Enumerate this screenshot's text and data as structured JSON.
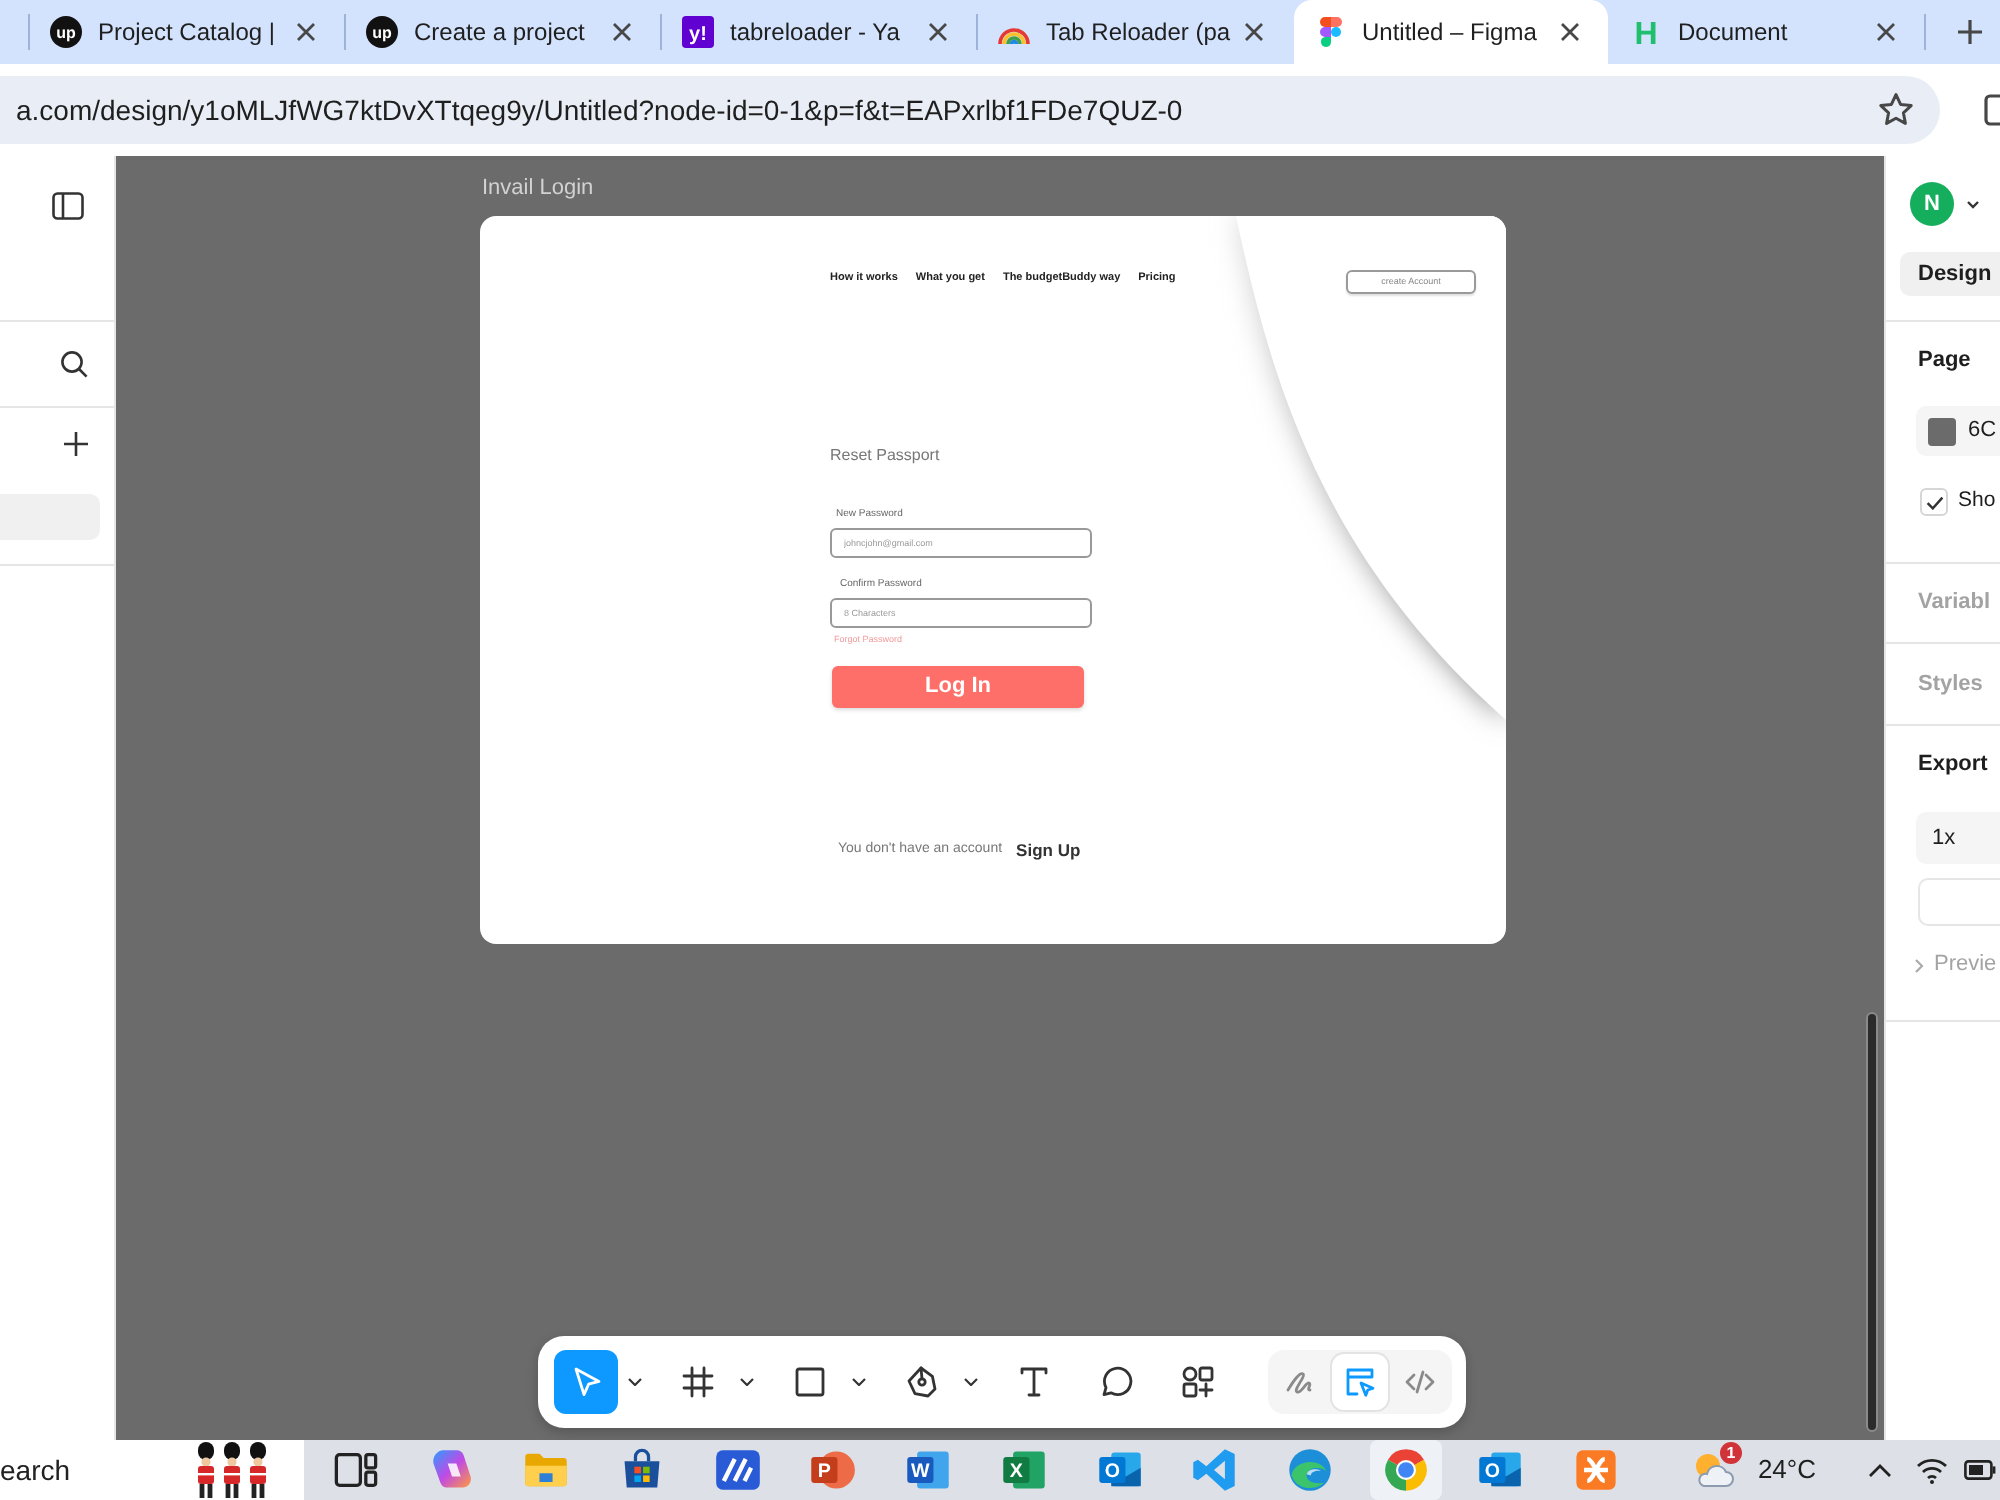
{
  "browser": {
    "tabs": [
      {
        "kind": "disc",
        "logo_text": "up",
        "title": "Project Catalog |",
        "selected": false
      },
      {
        "kind": "disc",
        "logo_text": "up",
        "title": "Create a project",
        "selected": false
      },
      {
        "kind": "tile",
        "logo_text": "y!",
        "title": "tabreloader - Ya",
        "selected": false
      },
      {
        "kind": "arc",
        "title": "Tab Reloader (pa",
        "selected": false
      },
      {
        "kind": "shapes",
        "title": "Untitled – Figma",
        "selected": true
      },
      {
        "kind": "letter",
        "logo_text": "H",
        "title": "Document",
        "selected": false
      }
    ],
    "address": "a.com/design/y1oMLJfWG7ktDvXTtqeg9y/Untitled?node-id=0-1&p=f&t=EAPxrlbf1FDe7QUZ-0"
  },
  "canvas": {
    "frame_label": "Invail Login",
    "frame": {
      "nav": [
        "How it works",
        "What you get",
        "The budgetBuddy way",
        "Pricing"
      ],
      "header_button": "create Account",
      "heading": "Reset Passport",
      "fields": [
        {
          "label": "New Password",
          "placeholder": "johncjohn@gmail.com"
        },
        {
          "label": "Confirm Password",
          "placeholder": "8 Characters"
        }
      ],
      "forgot_link": "Forgot Password",
      "submit": "Log In",
      "footer_text": "You don't have an account",
      "footer_link": "Sign Up"
    }
  },
  "toolbar": {
    "tools": [
      {
        "kind": "move",
        "selected": true,
        "dropdown": true
      },
      {
        "kind": "frame",
        "selected": false,
        "dropdown": true
      },
      {
        "kind": "shape",
        "selected": false,
        "dropdown": true
      },
      {
        "kind": "pen",
        "selected": false,
        "dropdown": true
      },
      {
        "kind": "text",
        "selected": false,
        "dropdown": false
      },
      {
        "kind": "comment",
        "selected": false,
        "dropdown": false
      },
      {
        "kind": "actions",
        "selected": false,
        "dropdown": false
      }
    ],
    "modes": [
      {
        "kind": "draw",
        "selected": false
      },
      {
        "kind": "design",
        "selected": true
      },
      {
        "kind": "code",
        "selected": false
      }
    ]
  },
  "right_panel": {
    "avatar": "N",
    "tabs": [
      {
        "label": "Design",
        "selected": true
      }
    ],
    "page": {
      "heading": "Page",
      "color_value": "6C",
      "show_option": {
        "label": "Sho",
        "checked": true
      }
    },
    "variables": "Variabl",
    "styles": "Styles",
    "export": {
      "heading": "Export",
      "scale": "1x",
      "preview": "Previe"
    }
  },
  "taskbar": {
    "search": {
      "placeholder": "earch"
    },
    "apps": [
      {
        "kind": "taskview",
        "active": false
      },
      {
        "kind": "assistant",
        "active": false
      },
      {
        "kind": "folder",
        "active": false
      },
      {
        "kind": "store",
        "active": false
      },
      {
        "kind": "slashes",
        "active": false
      },
      {
        "kind": "presentation",
        "logo_text": "P",
        "active": false
      },
      {
        "kind": "document",
        "logo_text": "W",
        "active": false
      },
      {
        "kind": "spreadsheet",
        "logo_text": "X",
        "active": false
      },
      {
        "kind": "mail",
        "logo_text": "O",
        "active": false
      },
      {
        "kind": "editor",
        "active": false
      },
      {
        "kind": "wave",
        "active": false
      },
      {
        "kind": "wheel",
        "active": true
      },
      {
        "kind": "mail",
        "logo_text": "O",
        "active": false
      },
      {
        "kind": "knot",
        "active": false
      }
    ],
    "weather": {
      "badge": "1",
      "temperature": "24°C"
    }
  }
}
